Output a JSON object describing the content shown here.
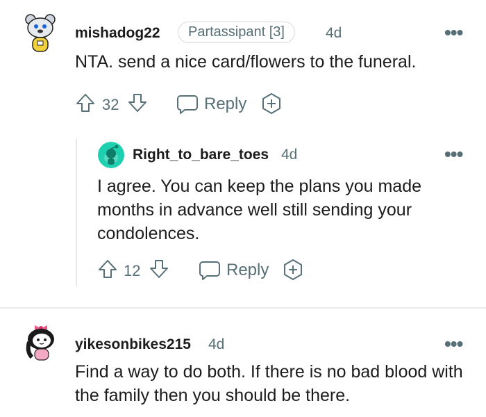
{
  "comments": [
    {
      "username": "mishadog22",
      "flair": "Partassipant [3]",
      "time": "4d",
      "body": "NTA. send a nice card/flowers to the funeral.",
      "votes": "32",
      "reply_label": "Reply",
      "avatar_icon": "snoo-dog-avatar-icon"
    },
    {
      "username": "Right_to_bare_toes",
      "time": "4d",
      "body": "I agree. You can keep the plans you made months in advance well still sending your condolences.",
      "votes": "12",
      "reply_label": "Reply",
      "avatar_icon": "snoo-teal-avatar-icon"
    },
    {
      "username": "yikesonbikes215",
      "time": "4d",
      "body": "Find a way to do both. If there is no bad blood with the family then you should be there.",
      "avatar_icon": "snoo-bow-avatar-icon"
    }
  ],
  "colors": {
    "text": "#1c1c1c",
    "meta": "#576f76",
    "border": "#d7dadc",
    "avatar_teal": "#1fd0b0"
  }
}
